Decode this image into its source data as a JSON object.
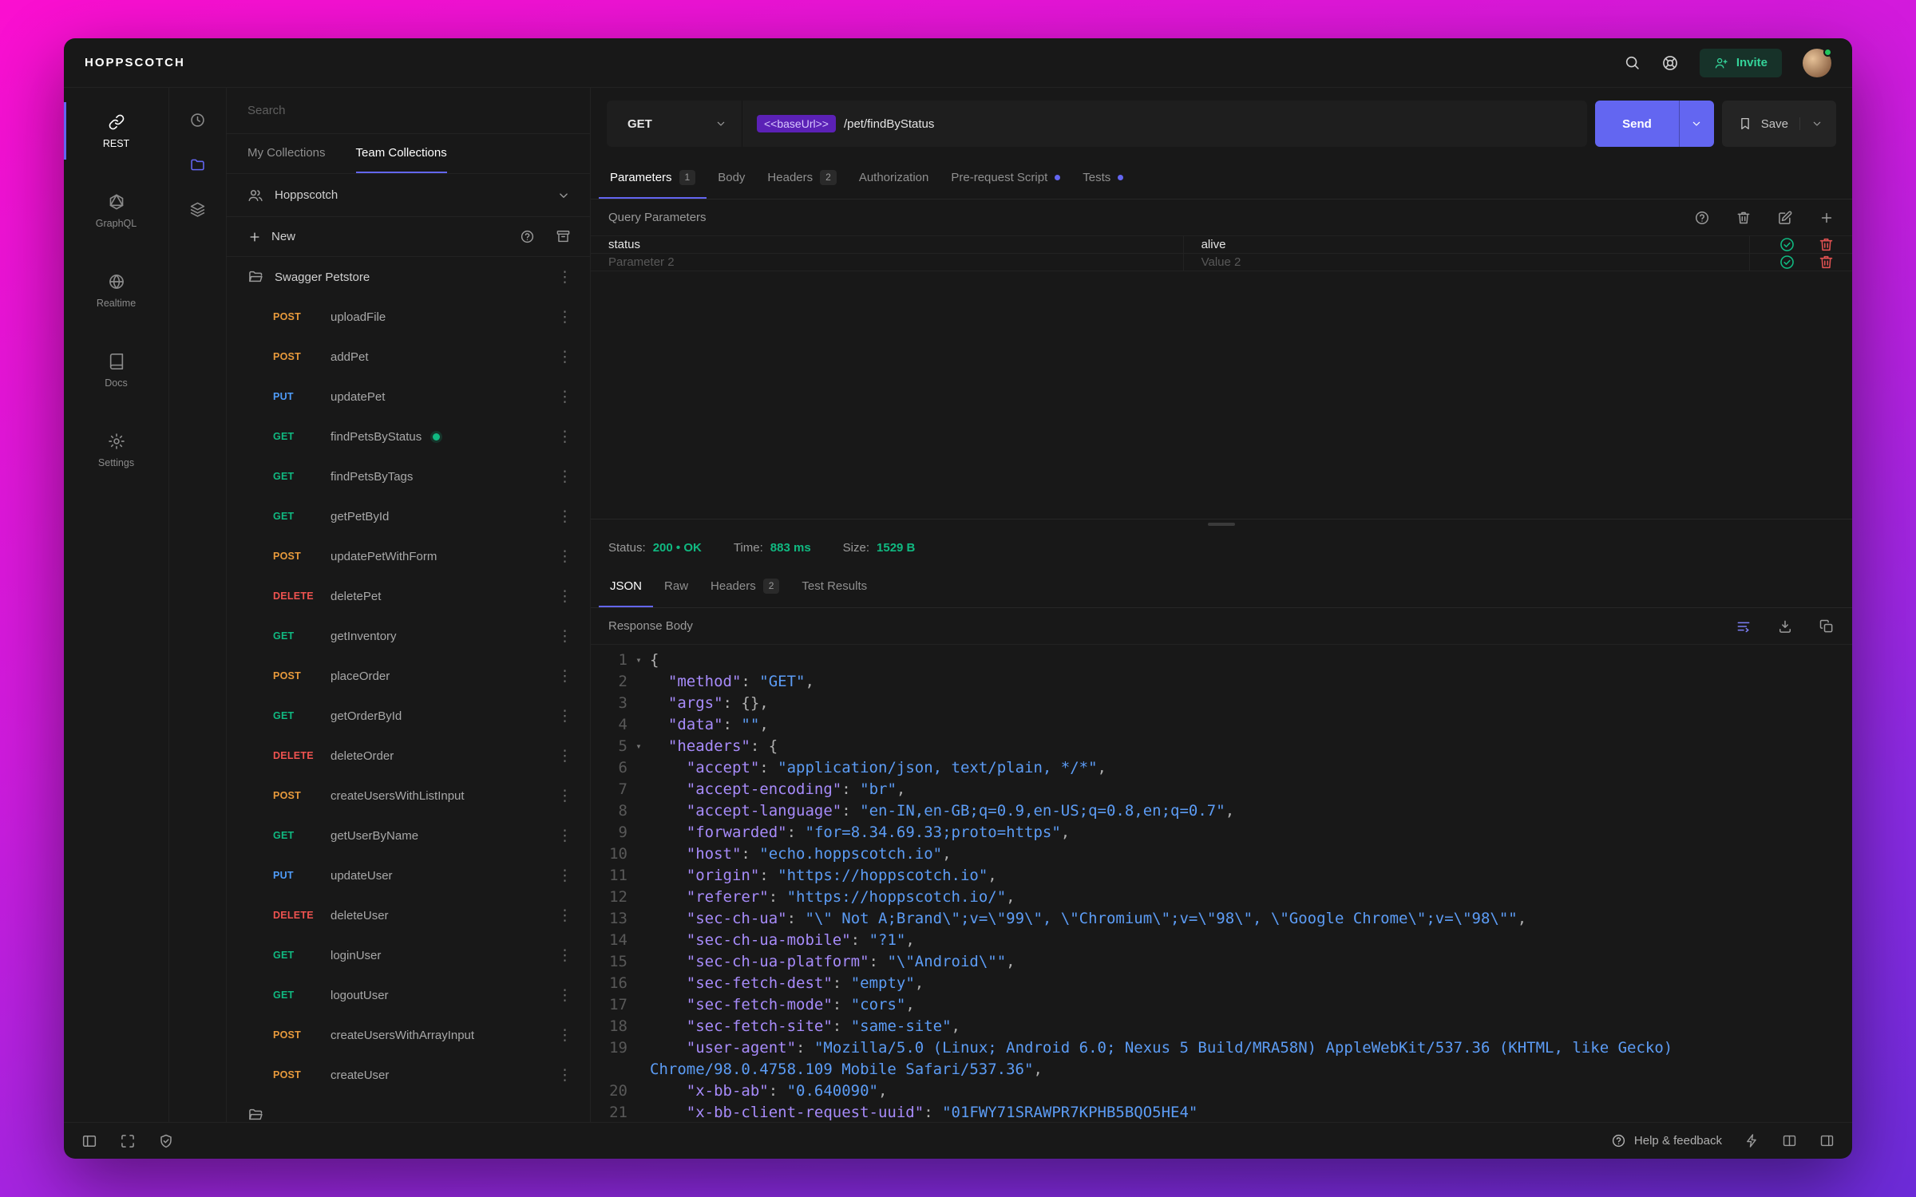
{
  "app": {
    "title": "HOPPSCOTCH",
    "invite_label": "Invite"
  },
  "icons": {
    "kebab": "⋮"
  },
  "nav": {
    "items": [
      {
        "label": "REST"
      },
      {
        "label": "GraphQL"
      },
      {
        "label": "Realtime"
      },
      {
        "label": "Docs"
      },
      {
        "label": "Settings"
      }
    ]
  },
  "collections": {
    "search_placeholder": "Search",
    "tabs": [
      {
        "label": "My Collections"
      },
      {
        "label": "Team Collections",
        "state": "active"
      }
    ],
    "team_name": "Hoppscotch",
    "new_label": "New",
    "folder_label": "Swagger Petstore",
    "requests": [
      {
        "method": "POST",
        "label": "uploadFile",
        "mcls": "m-post"
      },
      {
        "method": "POST",
        "label": "addPet",
        "mcls": "m-post"
      },
      {
        "method": "PUT",
        "label": "updatePet",
        "mcls": "m-put"
      },
      {
        "method": "GET",
        "label": "findPetsByStatus",
        "mcls": "m-get",
        "dotcls": "on"
      },
      {
        "method": "GET",
        "label": "findPetsByTags",
        "mcls": "m-get"
      },
      {
        "method": "GET",
        "label": "getPetById",
        "mcls": "m-get"
      },
      {
        "method": "POST",
        "label": "updatePetWithForm",
        "mcls": "m-post"
      },
      {
        "method": "DELETE",
        "label": "deletePet",
        "mcls": "m-delete"
      },
      {
        "method": "GET",
        "label": "getInventory",
        "mcls": "m-get"
      },
      {
        "method": "POST",
        "label": "placeOrder",
        "mcls": "m-post"
      },
      {
        "method": "GET",
        "label": "getOrderById",
        "mcls": "m-get"
      },
      {
        "method": "DELETE",
        "label": "deleteOrder",
        "mcls": "m-delete"
      },
      {
        "method": "POST",
        "label": "createUsersWithListInput",
        "mcls": "m-post"
      },
      {
        "method": "GET",
        "label": "getUserByName",
        "mcls": "m-get"
      },
      {
        "method": "PUT",
        "label": "updateUser",
        "mcls": "m-put"
      },
      {
        "method": "DELETE",
        "label": "deleteUser",
        "mcls": "m-delete"
      },
      {
        "method": "GET",
        "label": "loginUser",
        "mcls": "m-get"
      },
      {
        "method": "GET",
        "label": "logoutUser",
        "mcls": "m-get"
      },
      {
        "method": "POST",
        "label": "createUsersWithArrayInput",
        "mcls": "m-post"
      },
      {
        "method": "POST",
        "label": "createUser",
        "mcls": "m-post"
      }
    ]
  },
  "request": {
    "method": "GET",
    "base_url_token": "<<baseUrl>>",
    "path": "/pet/findByStatus",
    "send_label": "Send",
    "save_label": "Save",
    "tabs": [
      {
        "label": "Parameters",
        "badge": "1",
        "state": "active"
      },
      {
        "label": "Body"
      },
      {
        "label": "Headers",
        "badge": "2"
      },
      {
        "label": "Authorization"
      },
      {
        "label": "Pre-request Script",
        "dotcls": "on"
      },
      {
        "label": "Tests",
        "dotcls": "on"
      }
    ],
    "section_title": "Query Parameters",
    "params": [
      {
        "key": "status",
        "value": "alive"
      },
      {
        "key": "Parameter 2",
        "value": "Value 2",
        "rowcls": "ph"
      }
    ]
  },
  "response": {
    "meta": {
      "status_label": "Status:",
      "status_value": "200 • OK",
      "time_label": "Time:",
      "time_value": "883 ms",
      "size_label": "Size:",
      "size_value": "1529 B"
    },
    "tabs": [
      {
        "label": "JSON",
        "state": "active"
      },
      {
        "label": "Raw"
      },
      {
        "label": "Headers",
        "badge": "2"
      },
      {
        "label": "Test Results"
      }
    ],
    "body_title": "Response Body",
    "code_lines": [
      {
        "num": "1",
        "fold": "▾",
        "end": "{"
      },
      {
        "num": "2",
        "key": "  \"method\"",
        "sep": ": ",
        "val": "\"GET\"",
        "end": ","
      },
      {
        "num": "3",
        "key": "  \"args\"",
        "sep": ": ",
        "end": "{},"
      },
      {
        "num": "4",
        "key": "  \"data\"",
        "sep": ": ",
        "val": "\"\"",
        "end": ","
      },
      {
        "num": "5",
        "fold": "▾",
        "key": "  \"headers\"",
        "sep": ": ",
        "end": "{"
      },
      {
        "num": "6",
        "key": "    \"accept\"",
        "sep": ": ",
        "val": "\"application/json, text/plain, */*\"",
        "end": ","
      },
      {
        "num": "7",
        "key": "    \"accept-encoding\"",
        "sep": ": ",
        "val": "\"br\"",
        "end": ","
      },
      {
        "num": "8",
        "key": "    \"accept-language\"",
        "sep": ": ",
        "val": "\"en-IN,en-GB;q=0.9,en-US;q=0.8,en;q=0.7\"",
        "end": ","
      },
      {
        "num": "9",
        "key": "    \"forwarded\"",
        "sep": ": ",
        "val": "\"for=8.34.69.33;proto=https\"",
        "end": ","
      },
      {
        "num": "10",
        "key": "    \"host\"",
        "sep": ": ",
        "val": "\"echo.hoppscotch.io\"",
        "end": ","
      },
      {
        "num": "11",
        "key": "    \"origin\"",
        "sep": ": ",
        "val": "\"https://hoppscotch.io\"",
        "end": ","
      },
      {
        "num": "12",
        "key": "    \"referer\"",
        "sep": ": ",
        "val": "\"https://hoppscotch.io/\"",
        "end": ","
      },
      {
        "num": "13",
        "key": "    \"sec-ch-ua\"",
        "sep": ": ",
        "val": "\"\\\" Not A;Brand\\\";v=\\\"99\\\", \\\"Chromium\\\";v=\\\"98\\\", \\\"Google Chrome\\\";v=\\\"98\\\"\"",
        "end": ","
      },
      {
        "num": "14",
        "key": "    \"sec-ch-ua-mobile\"",
        "sep": ": ",
        "val": "\"?1\"",
        "end": ","
      },
      {
        "num": "15",
        "key": "    \"sec-ch-ua-platform\"",
        "sep": ": ",
        "val": "\"\\\"Android\\\"\"",
        "end": ","
      },
      {
        "num": "16",
        "key": "    \"sec-fetch-dest\"",
        "sep": ": ",
        "val": "\"empty\"",
        "end": ","
      },
      {
        "num": "17",
        "key": "    \"sec-fetch-mode\"",
        "sep": ": ",
        "val": "\"cors\"",
        "end": ","
      },
      {
        "num": "18",
        "key": "    \"sec-fetch-site\"",
        "sep": ": ",
        "val": "\"same-site\"",
        "end": ","
      },
      {
        "num": "19",
        "key": "    \"user-agent\"",
        "sep": ": ",
        "val": "\"Mozilla/5.0 (Linux; Android 6.0; Nexus 5 Build/MRA58N) AppleWebKit/537.36 (KHTML, like Gecko) Chrome/98.0.4758.109 Mobile Safari/537.36\"",
        "end": ","
      },
      {
        "num": "20",
        "key": "    \"x-bb-ab\"",
        "sep": ": ",
        "val": "\"0.640090\"",
        "end": ","
      },
      {
        "num": "21",
        "key": "    \"x-bb-client-request-uuid\"",
        "sep": ": ",
        "val": "\"01FWY71SRAWPR7KPHB5BQO5HE4\""
      }
    ]
  },
  "footer": {
    "help_label": "Help & feedback"
  }
}
